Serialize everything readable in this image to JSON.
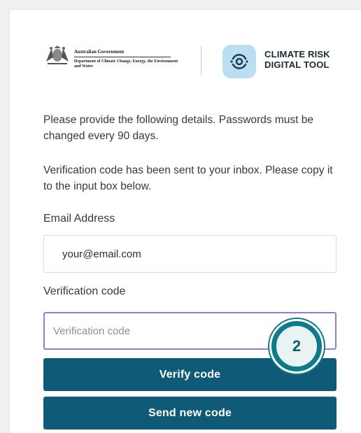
{
  "header": {
    "gov_title": "Australian Government",
    "gov_dept": "Department of Climate Change, Energy, the Environment and Water",
    "app_name_line1": "CLIMATE RISK",
    "app_name_line2": "DIGITAL TOOL"
  },
  "form": {
    "intro_text": "Please provide the following details. Passwords must be changed every 90 days.",
    "notice_text": "Verification code has been sent to your inbox. Please copy it to the input box below.",
    "email_label": "Email Address",
    "email_value": "your@email.com",
    "code_label": "Verification code",
    "code_placeholder": "Verification code",
    "verify_button": "Verify code",
    "send_button": "Send new code"
  },
  "annotation": {
    "step_number": "2"
  },
  "colors": {
    "button_bg": "#0e5a77",
    "focus_border": "#8d7fd1",
    "badge_accent": "#0e7b8a",
    "icon_bg": "#b9dff0"
  },
  "icons": {
    "gov_crest": "coat-of-arms-icon",
    "app_logo": "climate-risk-icon"
  }
}
